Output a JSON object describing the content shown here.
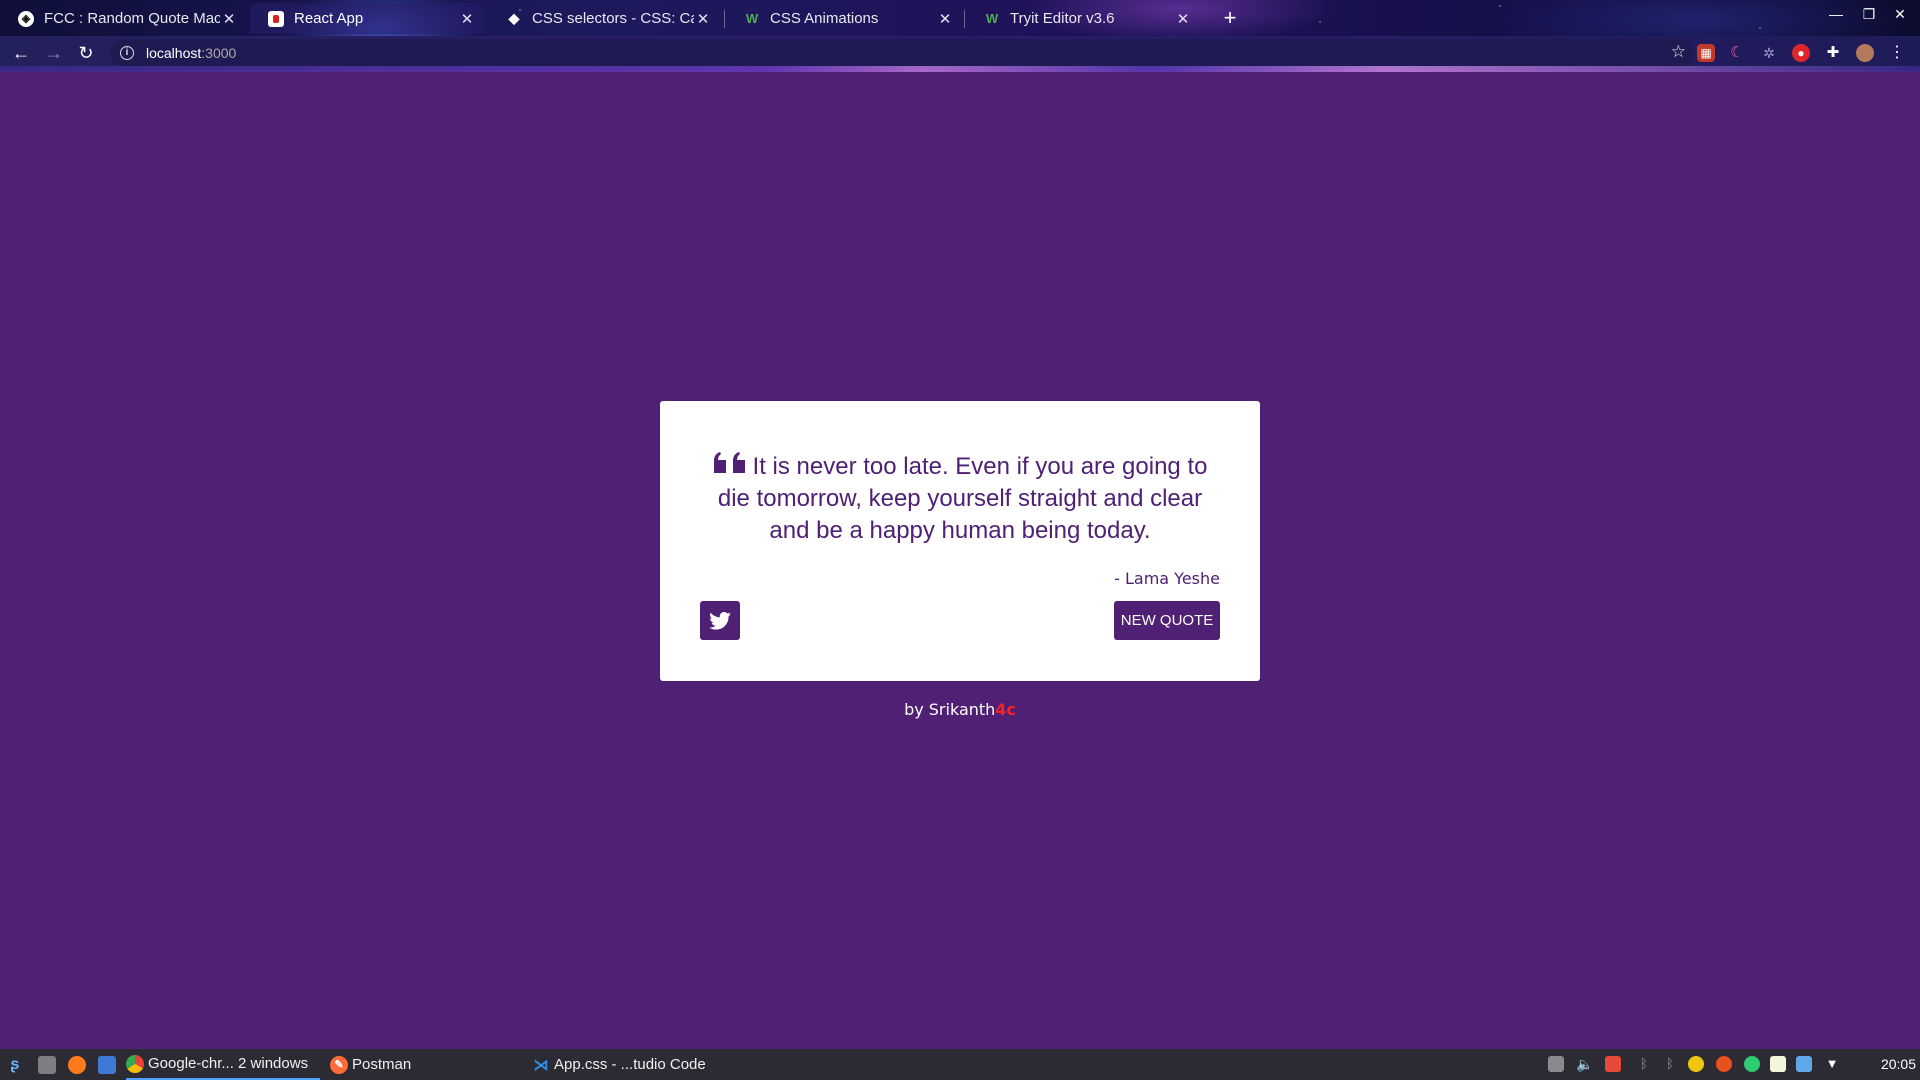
{
  "browser": {
    "tabs": [
      {
        "title": "FCC : Random Quote Mac",
        "active": false
      },
      {
        "title": "React App",
        "active": true
      },
      {
        "title": "CSS selectors - CSS: Casca",
        "active": false
      },
      {
        "title": "CSS Animations",
        "active": false
      },
      {
        "title": "Tryit Editor v3.6",
        "active": false
      }
    ],
    "new_tab_label": "+",
    "address": {
      "host": "localhost",
      "port": ":3000"
    }
  },
  "page": {
    "quote": "It is never too late. Even if you are going to die tomorrow, keep yourself straight and clear and be a happy human being today.",
    "author": "- Lama Yeshe",
    "new_quote_label": "NEW QUOTE",
    "byline_prefix": "by Srikanth",
    "byline_brand": "4c",
    "colors": {
      "primary": "#4f2074",
      "card": "#ffffff",
      "brand": "#ff2020"
    }
  },
  "taskbar": {
    "items": [
      {
        "label": "Google-chr... 2 windows",
        "icon": "chrome-icon"
      },
      {
        "label": "Postman",
        "icon": "postman-icon"
      },
      {
        "label": "App.css - ...tudio Code",
        "icon": "vscode-icon"
      }
    ],
    "clock": "20:05"
  }
}
